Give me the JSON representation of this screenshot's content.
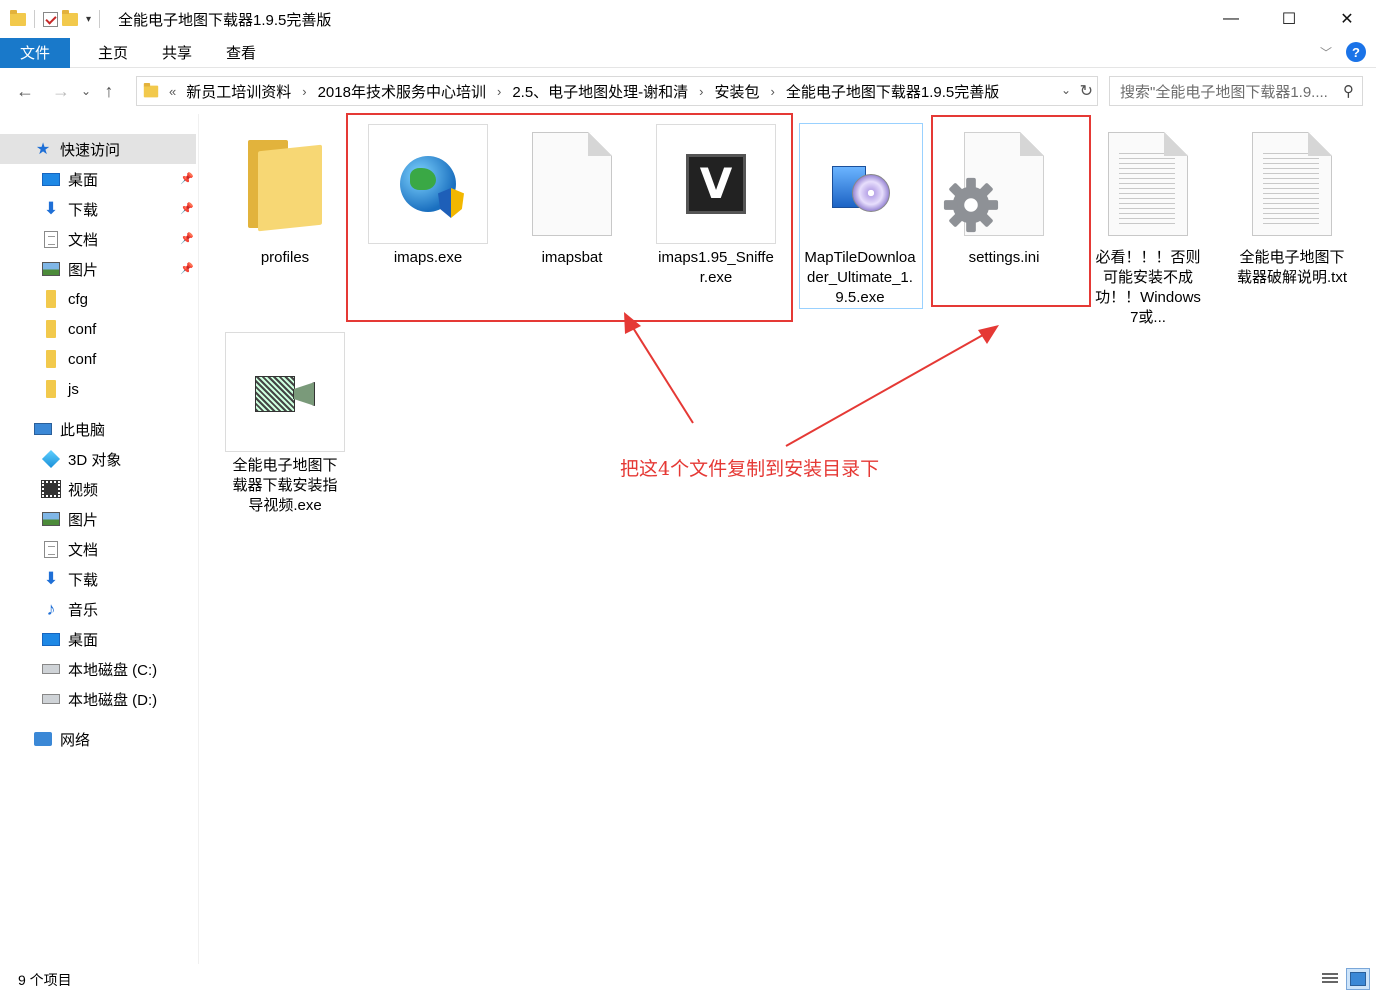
{
  "window": {
    "title": "全能电子地图下载器1.9.5完善版",
    "minimize": "—",
    "maximize": "☐",
    "close": "✕"
  },
  "ribbon": {
    "tabs": [
      "文件",
      "主页",
      "共享",
      "查看"
    ],
    "help": "?"
  },
  "address": {
    "crumbs": [
      "新员工培训资料",
      "2018年技术服务中心培训",
      "2.5、电子地图处理-谢和清",
      "安装包",
      "全能电子地图下载器1.9.5完善版"
    ],
    "overflow": "«",
    "search_placeholder": "搜索\"全能电子地图下载器1.9...."
  },
  "sidebar": {
    "quick_access": "快速访问",
    "quick_items": [
      "桌面",
      "下载",
      "文档",
      "图片",
      "cfg",
      "conf",
      "conf",
      "js"
    ],
    "this_pc": "此电脑",
    "pc_items": [
      "3D 对象",
      "视频",
      "图片",
      "文档",
      "下载",
      "音乐",
      "桌面",
      "本地磁盘 (C:)",
      "本地磁盘 (D:)"
    ],
    "network": "网络"
  },
  "files": [
    {
      "name": "profiles",
      "icon": "folder-icon"
    },
    {
      "name": "imaps.exe",
      "icon": "globe-shield-icon"
    },
    {
      "name": "imapsbat",
      "icon": "blank-file-icon"
    },
    {
      "name": "imaps1.95_Sniffer.exe",
      "icon": "v-app-icon"
    },
    {
      "name": "MapTileDownloader_Ultimate_1.9.5.exe",
      "icon": "installer-icon"
    },
    {
      "name": "settings.ini",
      "icon": "gear-file-icon"
    },
    {
      "name": "必看！！！否则可能安装不成功！！Windows 7或...",
      "icon": "text-file-icon"
    },
    {
      "name": "全能电子地图下载器破解说明.txt",
      "icon": "text-file-icon"
    },
    {
      "name": "全能电子地图下载器下载安装指导视频.exe",
      "icon": "camera-icon"
    }
  ],
  "annotation": {
    "text": "把这4个文件复制到安装目录下",
    "color": "#e53935"
  },
  "status": {
    "count": "9 个项目"
  },
  "colors": {
    "accent": "#1979ca",
    "folder": "#f7d774",
    "selection_border": "#99d1ff"
  }
}
